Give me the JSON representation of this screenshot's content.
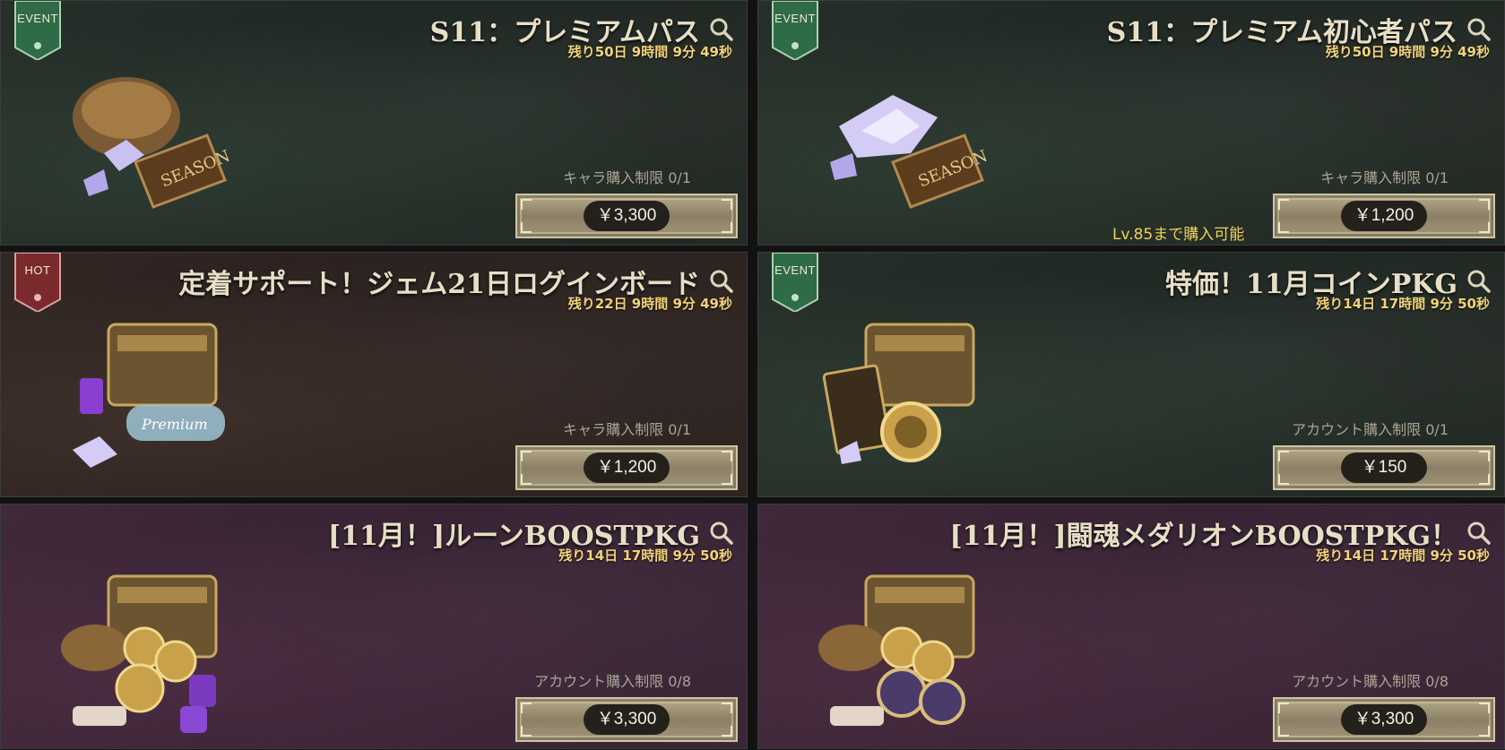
{
  "cards": [
    {
      "badge": "EVENT",
      "title": "S11：プレミアムパス",
      "timer": "残り50日 9時間 9分 49秒",
      "limit": "キャラ購入制限 0/1",
      "price": "￥3,300",
      "note": ""
    },
    {
      "badge": "EVENT",
      "title": "S11：プレミアム初心者パス",
      "timer": "残り50日 9時間 9分 49秒",
      "limit": "キャラ購入制限 0/1",
      "price": "￥1,200",
      "note": "Lv.85まで購入可能"
    },
    {
      "badge": "HOT",
      "title": "定着サポート！ジェム21日ログインボード",
      "timer": "残り22日 9時間 9分 49秒",
      "limit": "キャラ購入制限 0/1",
      "price": "￥1,200",
      "note": ""
    },
    {
      "badge": "EVENT",
      "title": "特価！11月コインPKG",
      "timer": "残り14日 17時間 9分 50秒",
      "limit": "アカウント購入制限 0/1",
      "price": "￥150",
      "note": ""
    },
    {
      "badge": "",
      "title": "[11月！]ルーンBOOSTPKG",
      "timer": "残り14日 17時間 9分 50秒",
      "limit": "アカウント購入制限 0/8",
      "price": "￥3,300",
      "note": ""
    },
    {
      "badge": "",
      "title": "[11月！]闘魂メダリオンBOOSTPKG！",
      "timer": "残り14日 17時間 9分 50秒",
      "limit": "アカウント購入制限 0/8",
      "price": "￥3,300",
      "note": ""
    }
  ],
  "art_labels": {
    "season": "SEASON",
    "premium": "Premium"
  },
  "colors": {
    "event_badge": "#2e6b46",
    "hot_badge": "#7a2a2c",
    "timer": "#f2d27a",
    "note": "#f1d05a"
  }
}
